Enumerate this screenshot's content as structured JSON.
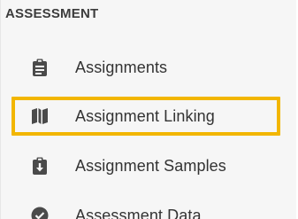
{
  "sidebar": {
    "section_title": "ASSESSMENT",
    "items": [
      {
        "label": "Assignments",
        "icon": "clipboard-icon"
      },
      {
        "label": "Assignment Linking",
        "icon": "map-icon"
      },
      {
        "label": "Assignment Samples",
        "icon": "clipboard-download-icon"
      },
      {
        "label": "Assessment Data",
        "icon": "check-circle-icon"
      }
    ]
  },
  "colors": {
    "highlight": "#f2b600",
    "text": "#333333",
    "icon": "#4a4a4a",
    "background": "#f6f6f6"
  }
}
